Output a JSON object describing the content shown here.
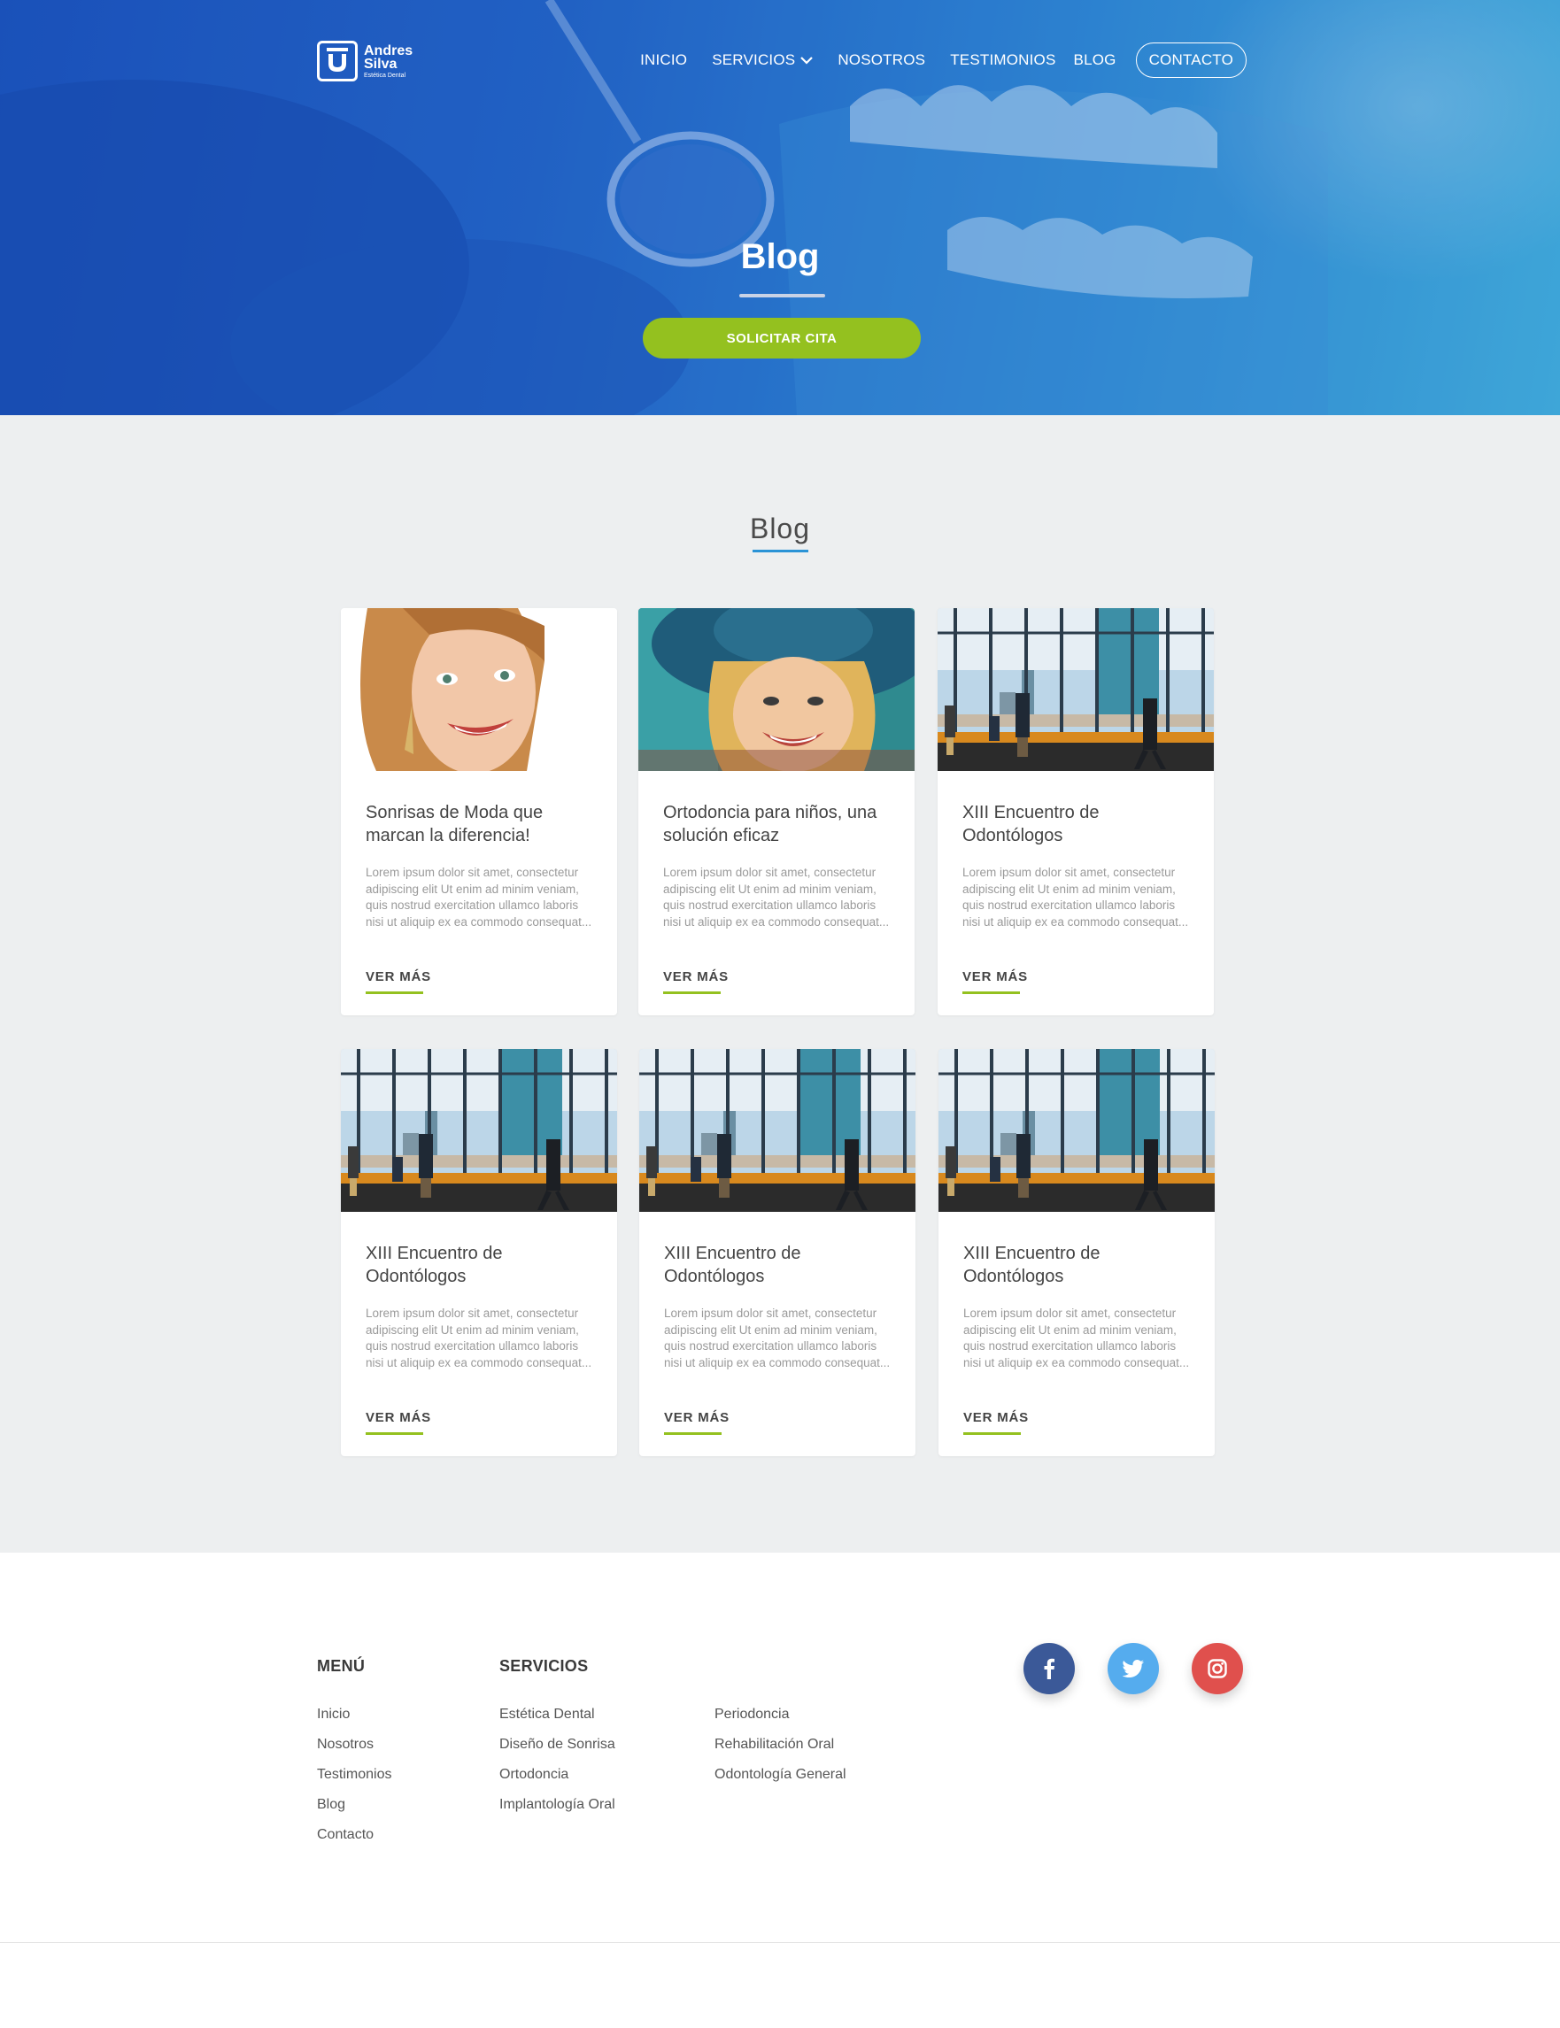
{
  "brand": {
    "name_line1": "Andres",
    "name_line2": "Silva",
    "tagline": "Estética Dental"
  },
  "nav": {
    "items": [
      {
        "label": "INICIO"
      },
      {
        "label": "SERVICIOS",
        "dropdown": true
      },
      {
        "label": "NOSOTROS"
      },
      {
        "label": "TESTIMONIOS"
      },
      {
        "label": "BLOG"
      },
      {
        "label": "CONTACTO"
      }
    ]
  },
  "hero": {
    "title": "Blog",
    "cta_label": "SOLICITAR CITA"
  },
  "blog": {
    "section_title": "Blog",
    "cards": [
      {
        "title": "Sonrisas de Moda que marcan la diferencia!",
        "excerpt": "Lorem ipsum dolor sit amet, consectetur adipiscing elit Ut enim ad minim veniam, quis nostrud exercitation ullamco laboris nisi ut aliquip ex ea commodo consequat...",
        "more_label": "VER MÁS",
        "image": "woman-smiling"
      },
      {
        "title": "Ortodoncia para niños, una solución eficaz",
        "excerpt": "Lorem ipsum dolor sit amet, consectetur adipiscing elit Ut enim ad minim veniam, quis nostrud exercitation ullamco laboris nisi ut aliquip ex ea commodo consequat...",
        "more_label": "VER MÁS",
        "image": "child-smiling-hat"
      },
      {
        "title": "XIII Encuentro de Odontólogos",
        "excerpt": "Lorem ipsum dolor sit amet, consectetur adipiscing elit Ut enim ad minim veniam, quis nostrud exercitation ullamco laboris nisi ut aliquip ex ea commodo consequat...",
        "more_label": "VER MÁS",
        "image": "observation-deck"
      },
      {
        "title": "XIII Encuentro de Odontólogos",
        "excerpt": "Lorem ipsum dolor sit amet, consectetur adipiscing elit Ut enim ad minim veniam, quis nostrud exercitation ullamco laboris nisi ut aliquip ex ea commodo consequat...",
        "more_label": "VER MÁS",
        "image": "observation-deck"
      },
      {
        "title": "XIII Encuentro de Odontólogos",
        "excerpt": "Lorem ipsum dolor sit amet, consectetur adipiscing elit Ut enim ad minim veniam, quis nostrud exercitation ullamco laboris nisi ut aliquip ex ea commodo consequat...",
        "more_label": "VER MÁS",
        "image": "observation-deck"
      },
      {
        "title": "XIII Encuentro de Odontólogos",
        "excerpt": "Lorem ipsum dolor sit amet, consectetur adipiscing elit Ut enim ad minim veniam, quis nostrud exercitation ullamco laboris nisi ut aliquip ex ea commodo consequat...",
        "more_label": "VER MÁS",
        "image": "observation-deck"
      }
    ]
  },
  "footer": {
    "menu": {
      "heading": "MENÚ",
      "links": [
        "Inicio",
        "Nosotros",
        "Testimonios",
        "Blog",
        "Contacto"
      ]
    },
    "services": {
      "heading": "SERVICIOS",
      "col1": [
        "Estética Dental",
        "Diseño de Sonrisa",
        "Ortodoncia",
        "Implantología Oral"
      ],
      "col2": [
        "Periodoncia",
        "Rehabilitación Oral",
        "Odontología General"
      ]
    },
    "social": [
      {
        "icon": "facebook-icon",
        "color": "#3b5998"
      },
      {
        "icon": "twitter-icon",
        "color": "#55acee"
      },
      {
        "icon": "instagram-icon",
        "color": "#e0504d"
      }
    ]
  },
  "colors": {
    "accent_green": "#94c11f",
    "accent_blue": "#2a93d6",
    "hero_blue": "#2362c4",
    "section_bg": "#edeff0"
  }
}
